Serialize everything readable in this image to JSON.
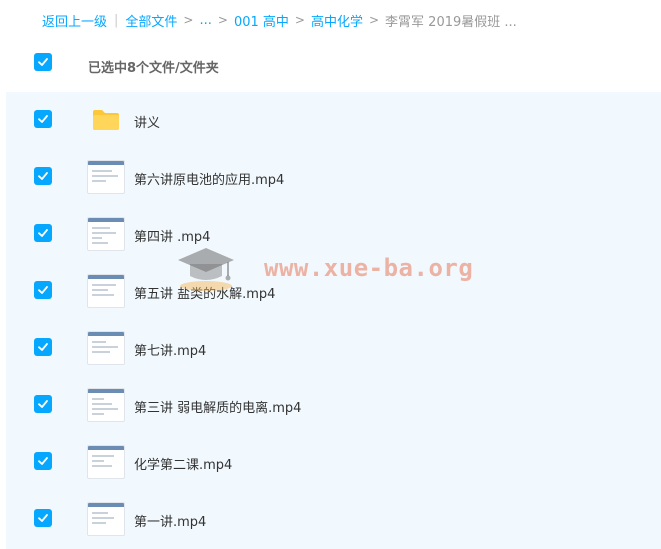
{
  "breadcrumb": {
    "back": "返回上一级",
    "items": [
      "全部文件",
      "...",
      "001 高中",
      "高中化学"
    ],
    "current": "李霄军 2019暑假班 ..."
  },
  "header": {
    "selected_text": "已选中8个文件/文件夹"
  },
  "files": [
    {
      "name": "讲义",
      "type": "folder",
      "checked": true
    },
    {
      "name": "第六讲原电池的应用.mp4",
      "type": "video",
      "checked": true
    },
    {
      "name": "第四讲 .mp4",
      "type": "video",
      "checked": true
    },
    {
      "name": "第五讲 盐类的水解.mp4",
      "type": "video",
      "checked": true
    },
    {
      "name": "第七讲.mp4",
      "type": "video",
      "checked": true
    },
    {
      "name": "第三讲 弱电解质的电离.mp4",
      "type": "video",
      "checked": true
    },
    {
      "name": "化学第二课.mp4",
      "type": "video",
      "checked": true
    },
    {
      "name": "第一讲.mp4",
      "type": "video",
      "checked": true
    }
  ],
  "watermark": "www.xue-ba.org",
  "icons": {
    "checkbox": "check-icon",
    "folder": "folder-icon",
    "video": "video-thumbnail-icon",
    "watermark": "graduation-cap-icon"
  },
  "colors": {
    "accent": "#06a7ff",
    "list_background": "#f2f9fe",
    "folder": "#fcc837",
    "muted_text": "#999999"
  }
}
